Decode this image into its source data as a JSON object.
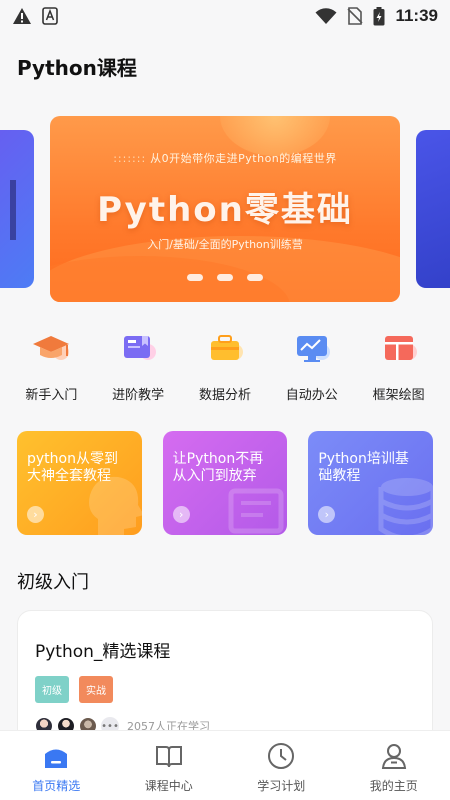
{
  "status_bar": {
    "time": "11:39",
    "left_icons": [
      "warning-icon",
      "font-a-icon"
    ],
    "right_icons": [
      "wifi-icon",
      "no-sim-icon",
      "battery-charging-icon"
    ]
  },
  "page_title": "Python课程",
  "banner": {
    "slogan": "从0开始带你走进Python的编程世界",
    "title": "Python零基础",
    "subtitle": "入门/基础/全面的Python训练营",
    "dots": 3
  },
  "categories": [
    {
      "label": "新手入门",
      "icon": "graduation-cap-icon"
    },
    {
      "label": "进阶教学",
      "icon": "book-bookmark-icon"
    },
    {
      "label": "数据分析",
      "icon": "briefcase-icon"
    },
    {
      "label": "自动办公",
      "icon": "monitor-chart-icon"
    },
    {
      "label": "框架绘图",
      "icon": "layout-frame-icon"
    }
  ],
  "course_cards": [
    {
      "title_line1": "python从零到",
      "title_line2": "大神全套教程"
    },
    {
      "title_line1": "让Python不再",
      "title_line2": "从入门到放弃"
    },
    {
      "title_line1": "Python培训基",
      "title_line2": "础教程"
    }
  ],
  "section_title": "初级入门",
  "course": {
    "title": "Python_精选课程",
    "tags": [
      "初级",
      "实战"
    ],
    "learners_text": "2057人正在学习"
  },
  "bottom_nav": [
    {
      "label": "首页精选",
      "icon": "home-icon",
      "active": true
    },
    {
      "label": "课程中心",
      "icon": "open-book-icon",
      "active": false
    },
    {
      "label": "学习计划",
      "icon": "clock-icon",
      "active": false
    },
    {
      "label": "我的主页",
      "icon": "user-icon",
      "active": false
    }
  ],
  "colors": {
    "accent": "#3a78f2",
    "banner_orange": "#ff7a2c",
    "tag_teal": "#7fd1c8",
    "tag_orange": "#f28a5c"
  }
}
